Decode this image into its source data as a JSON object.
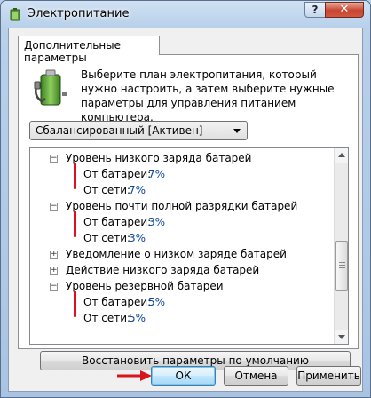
{
  "window": {
    "title": "Электропитание",
    "help_label": "?",
    "close_label": "✕"
  },
  "tab": {
    "label": "Дополнительные параметры"
  },
  "description": "Выберите план электропитания, который нужно настроить, а затем выберите нужные параметры для управления питанием компьютера.",
  "plan_select": {
    "value": "Сбалансированный [Активен]"
  },
  "tree": {
    "items": [
      {
        "label": "Уровень низкого заряда батарей",
        "expander": "−",
        "expanded": true
      },
      {
        "label": "От батареи:",
        "value": "7%"
      },
      {
        "label": "От сети:",
        "value": "7%"
      },
      {
        "label": "Уровень почти полной разрядки батарей",
        "expander": "−",
        "expanded": true
      },
      {
        "label": "От батареи:",
        "value": "3%"
      },
      {
        "label": "От сети:",
        "value": "3%"
      },
      {
        "label": "Уведомление о низком заряде батарей",
        "expander": "+",
        "expanded": false
      },
      {
        "label": "Действие низкого заряда батарей",
        "expander": "+",
        "expanded": false
      },
      {
        "label": "Уровень резервной батареи",
        "expander": "−",
        "expanded": true
      },
      {
        "label": "От батареи:",
        "value": "5%"
      },
      {
        "label": "От сети:",
        "value": "5%"
      }
    ]
  },
  "buttons": {
    "restore": "Восстановить параметры по умолчанию",
    "ok": "ОК",
    "cancel": "Отмена",
    "apply": "Применить"
  },
  "colors": {
    "link": "#0b48a4",
    "annotation": "#d9131d"
  }
}
